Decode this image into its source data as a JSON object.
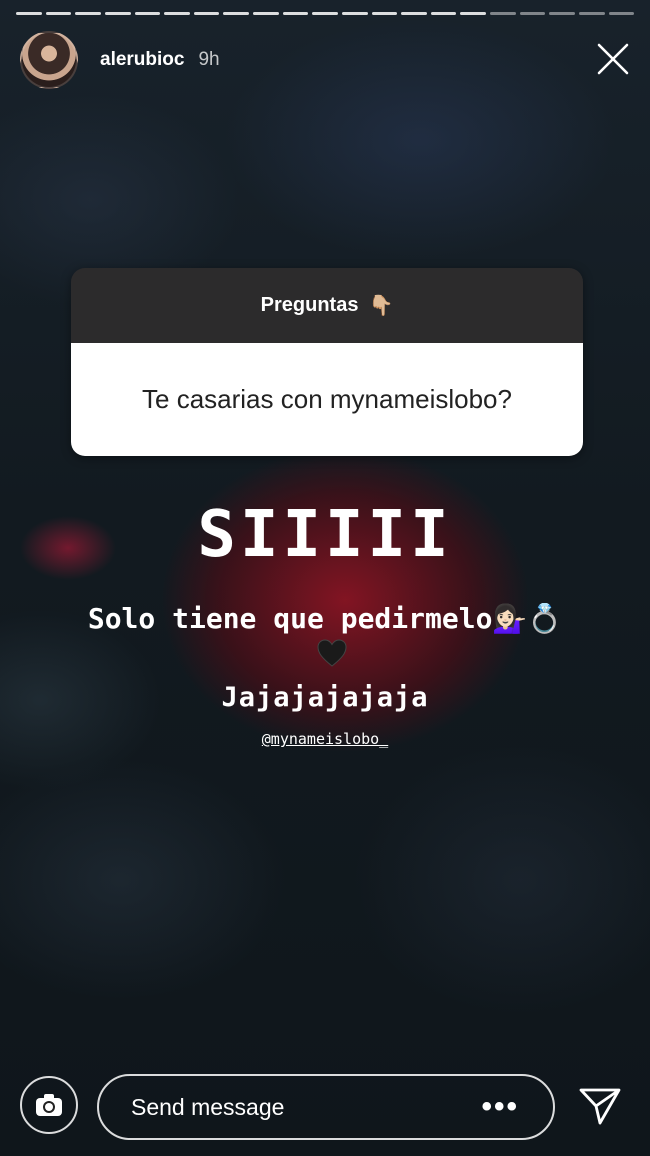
{
  "story": {
    "username": "alerubioc",
    "time_ago": "9h",
    "progress": {
      "segments": 21,
      "viewed": 16
    }
  },
  "question_sticker": {
    "header": "Preguntas",
    "header_emoji": "👇🏼",
    "question": "Te casarias con mynameislobo?"
  },
  "story_text": {
    "headline": "SIIIII",
    "line2": "Solo tiene que pedirmelo💁🏻‍♀️💍",
    "line3": "Jajajajajaja",
    "mention": "@mynameislobo_"
  },
  "reply_bar": {
    "placeholder": "Send message",
    "more_label": "•••"
  },
  "icons": [
    "close-icon",
    "camera-icon",
    "more-options-icon",
    "send-icon",
    "black-heart-icon"
  ],
  "colors": {
    "card_header": "#2c2b2c",
    "card_body": "#ffffff",
    "text": "#ffffff"
  }
}
